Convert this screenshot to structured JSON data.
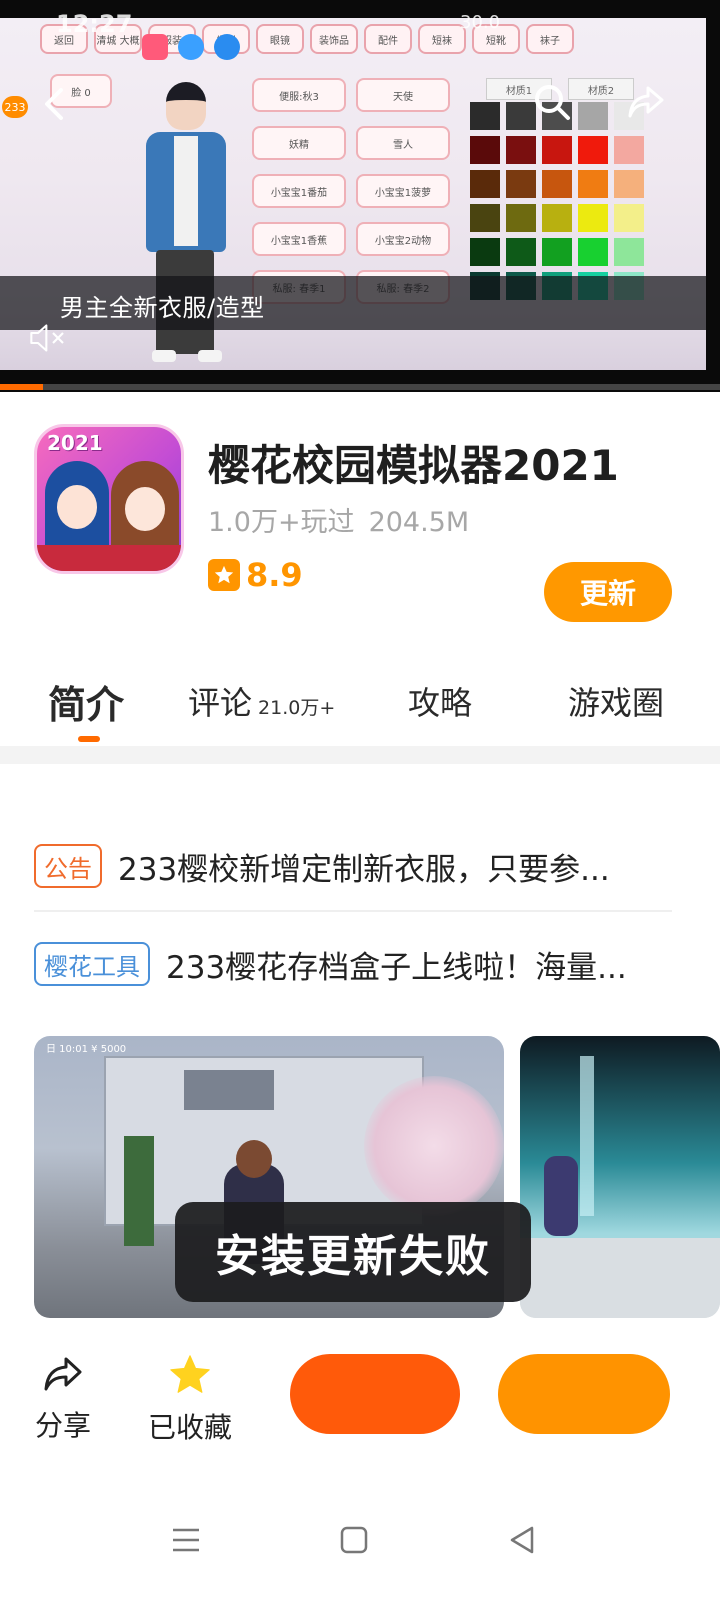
{
  "status_bar": {
    "time": "12:27",
    "right_text": "30.0"
  },
  "video": {
    "caption": "男主全新衣服/造型",
    "badge": "233",
    "progress": 0.06,
    "game_ui": {
      "tabs": [
        "返回",
        "清城 大概",
        "服装",
        "发型",
        "眼镜",
        "装饰品",
        "配件",
        "短袜",
        "短靴",
        "袜子"
      ],
      "face_button": "脸 0",
      "material_tabs": [
        "材质1",
        "材质2"
      ],
      "buttons": [
        "便服:秋3",
        "天使",
        "妖精",
        "雪人",
        "小宝宝1番茄",
        "小宝宝1菠萝",
        "小宝宝1香蕉",
        "小宝宝2动物",
        "私服: 春季1",
        "私服: 春季2"
      ],
      "swatches": [
        "#2b2b2b",
        "#3a3a3a",
        "#4d4d4d",
        "#a6a6a6",
        "#e8e8e8",
        "#5a0a0a",
        "#7a0f0f",
        "#c8160f",
        "#f01a0c",
        "#f3a8a0",
        "#5a2a0a",
        "#7a3a10",
        "#c7560e",
        "#f07c12",
        "#f5b07c",
        "#4a4410",
        "#6e6a10",
        "#b8b010",
        "#ecea10",
        "#f3ef8a",
        "#0a3a10",
        "#0e5a18",
        "#12a020",
        "#18d030",
        "#8ee69a",
        "#0a3a30",
        "#0e5a4a",
        "#10a07c",
        "#16d0a0",
        "#8ee6c8"
      ]
    }
  },
  "app": {
    "icon_text": "2021",
    "title": "樱花校园模拟器2021",
    "players": "1.0万+玩过",
    "size": "204.5M",
    "rating": "8.9",
    "update_button": "更新"
  },
  "tabs": [
    {
      "label": "简介",
      "count": ""
    },
    {
      "label": "评论",
      "count": "21.0万+"
    },
    {
      "label": "攻略",
      "count": ""
    },
    {
      "label": "游戏圈",
      "count": ""
    }
  ],
  "notices": [
    {
      "tag": "公告",
      "text": "233樱校新增定制新衣服，只要参..."
    },
    {
      "tag": "樱花工具",
      "text": "233樱花存档盒子上线啦！海量..."
    }
  ],
  "screenshots": [
    {
      "overlay": "日 10:01 ¥ 5000"
    }
  ],
  "toast": "安装更新失败",
  "bottom_bar": {
    "share_label": "分享",
    "favorite_label": "已收藏"
  },
  "colors": {
    "accent_orange": "#ff9800",
    "accent_red": "#ff5a0a",
    "rating": "#ff9500",
    "tag_orange": "#f06b2c",
    "tag_blue": "#4a90d9",
    "favorite_star": "#ffd21f"
  },
  "icons": {
    "back": "chevron-left-icon",
    "search": "search-icon",
    "share_video": "share-arrow-icon",
    "mute": "mute-icon",
    "share": "share-icon",
    "favorite": "star-icon",
    "menu": "menu-icon",
    "home": "home-icon",
    "back_nav": "back-triangle-icon"
  }
}
